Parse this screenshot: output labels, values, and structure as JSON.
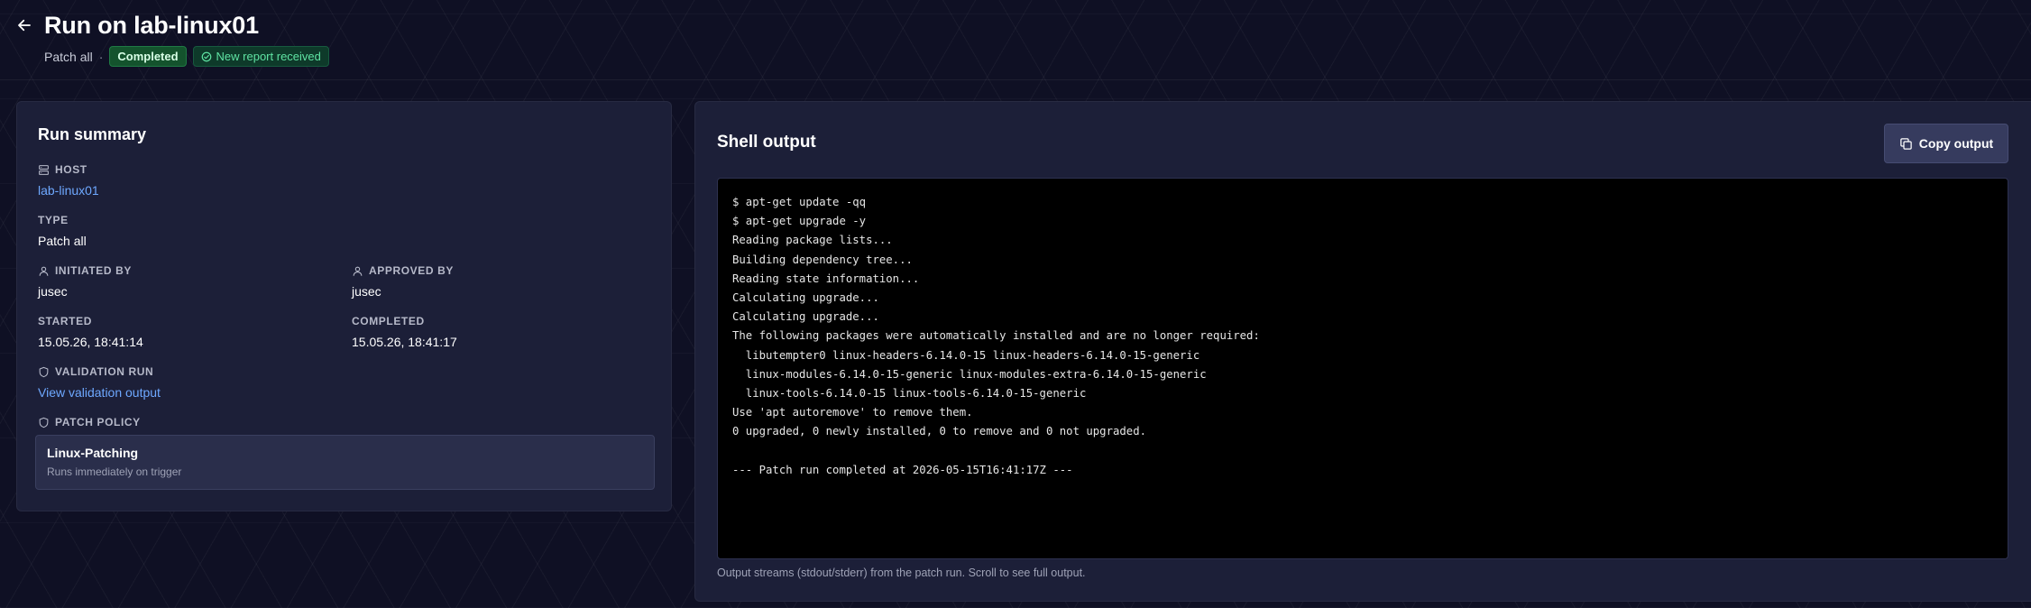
{
  "header": {
    "title": "Run on lab-linux01",
    "type": "Patch all",
    "separator": "·",
    "status_badge": "Completed",
    "report_badge": "New report received"
  },
  "summary": {
    "title": "Run summary",
    "host": {
      "label": "HOST",
      "value": "lab-linux01"
    },
    "type": {
      "label": "TYPE",
      "value": "Patch all"
    },
    "initiated_by": {
      "label": "INITIATED BY",
      "value": "jusec"
    },
    "approved_by": {
      "label": "APPROVED BY",
      "value": "jusec"
    },
    "started": {
      "label": "STARTED",
      "value": "15.05.26, 18:41:14"
    },
    "completed": {
      "label": "COMPLETED",
      "value": "15.05.26, 18:41:17"
    },
    "validation": {
      "label": "VALIDATION RUN",
      "link": "View validation output"
    },
    "policy": {
      "label": "PATCH POLICY",
      "name": "Linux-Patching",
      "description": "Runs immediately on trigger"
    }
  },
  "shell": {
    "title": "Shell output",
    "copy_label": "Copy output",
    "lines": [
      "$ apt-get update -qq",
      "$ apt-get upgrade -y",
      "Reading package lists...",
      "Building dependency tree...",
      "Reading state information...",
      "Calculating upgrade...",
      "Calculating upgrade...",
      "The following packages were automatically installed and are no longer required:",
      "  libutempter0 linux-headers-6.14.0-15 linux-headers-6.14.0-15-generic",
      "  linux-modules-6.14.0-15-generic linux-modules-extra-6.14.0-15-generic",
      "  linux-tools-6.14.0-15 linux-tools-6.14.0-15-generic",
      "Use 'apt autoremove' to remove them.",
      "0 upgraded, 0 newly installed, 0 to remove and 0 not upgraded.",
      "",
      "--- Patch run completed at 2026-05-15T16:41:17Z ---"
    ],
    "note": "Output streams (stdout/stderr) from the patch run. Scroll to see full output."
  },
  "colors": {
    "background": "#0f1024",
    "card": "#1c1f38",
    "accent_link": "#6ea8ff",
    "success_badge": "#14532d",
    "success_text": "#5fe3a3"
  },
  "icons": {
    "back": "arrow-left-icon",
    "report": "check-circle-icon",
    "host": "server-icon",
    "user": "user-icon",
    "validation": "shield-icon",
    "policy": "shield-icon",
    "copy": "copy-icon"
  }
}
